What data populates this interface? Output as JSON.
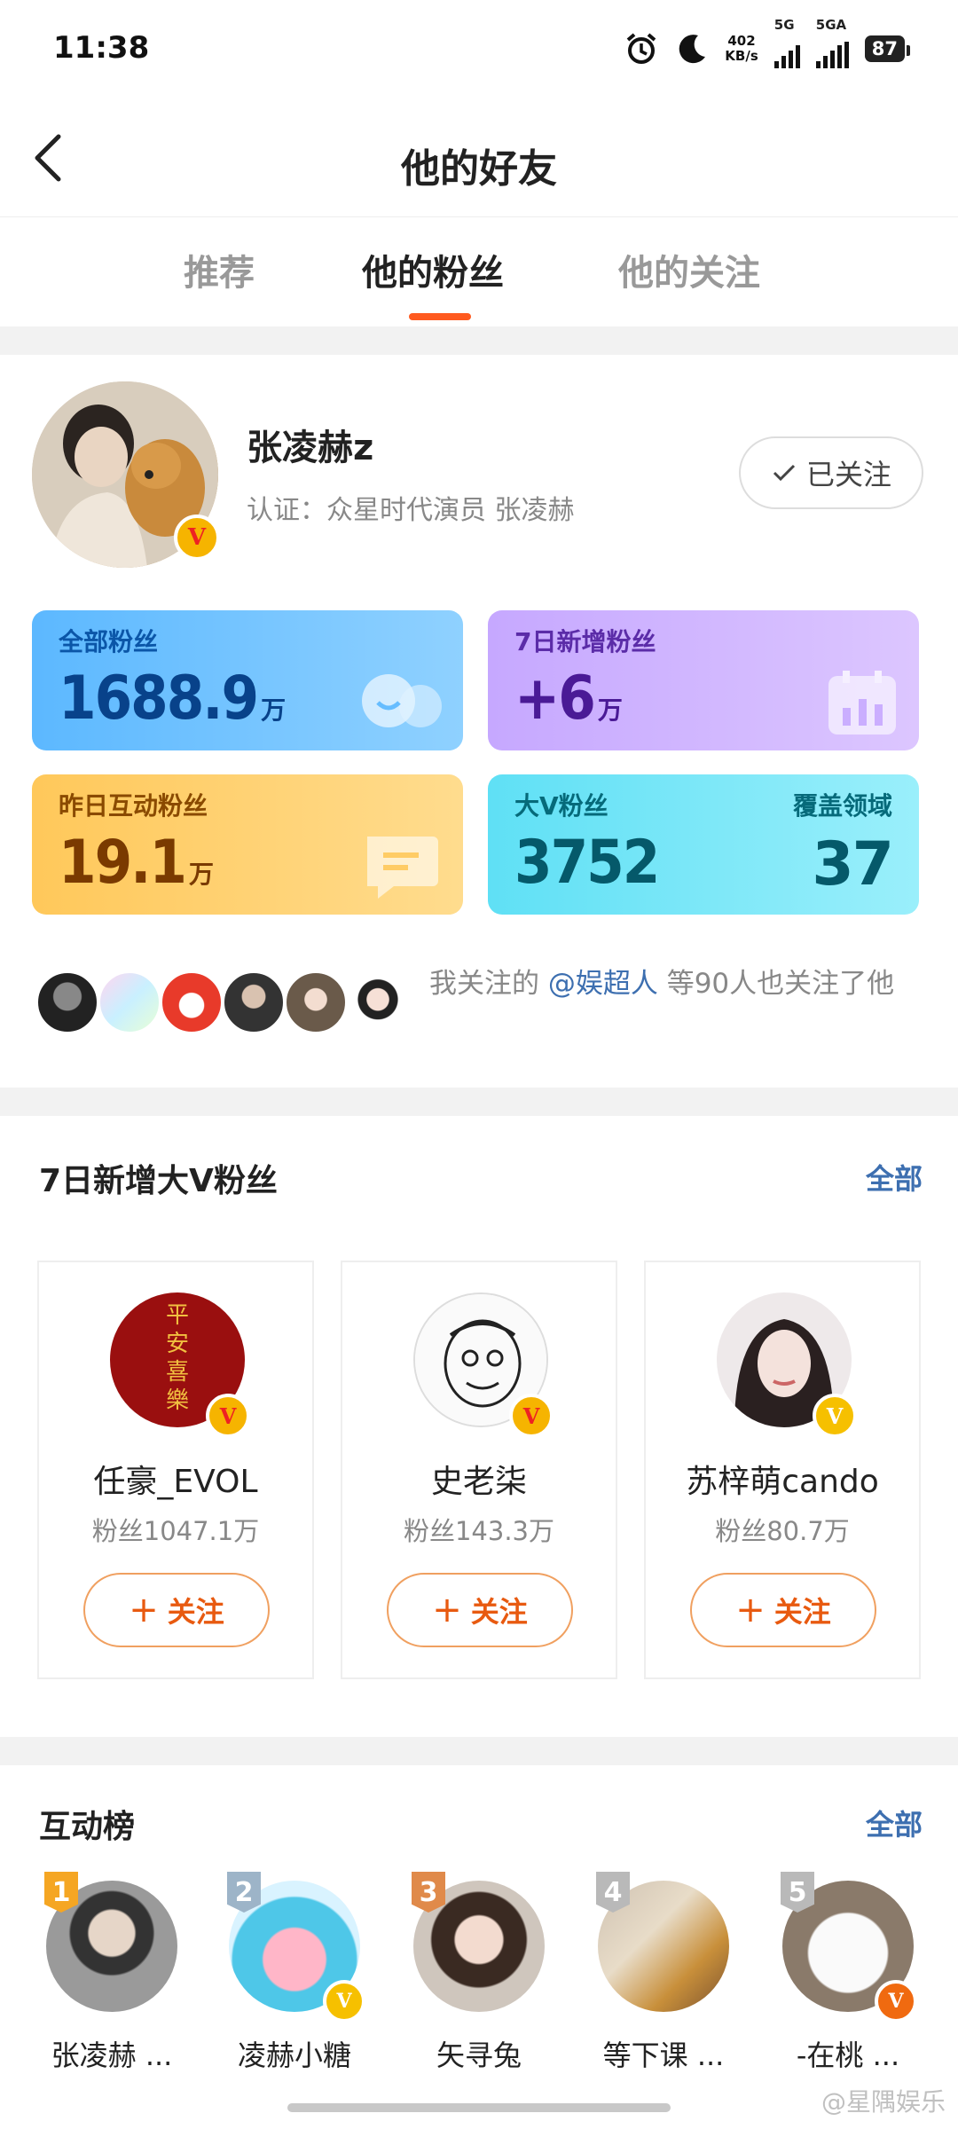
{
  "status_bar": {
    "time": "11:38",
    "net_speed_value": "402",
    "net_speed_unit": "KB/s",
    "sim1": "5G",
    "sim2": "5GA",
    "battery": "87"
  },
  "header": {
    "title": "他的好友"
  },
  "tabs": [
    {
      "label": "推荐",
      "active": false
    },
    {
      "label": "他的粉丝",
      "active": true
    },
    {
      "label": "他的关注",
      "active": false
    }
  ],
  "profile": {
    "name": "张凌赫z",
    "certification": "认证：众星时代演员 张凌赫",
    "follow_state": "已关注",
    "badge": "V"
  },
  "stats": {
    "all_fans": {
      "label": "全部粉丝",
      "value": "1688.9",
      "unit": "万"
    },
    "new_7d": {
      "label": "7日新增粉丝",
      "value": "+6",
      "unit": "万"
    },
    "interact_yesterday": {
      "label": "昨日互动粉丝",
      "value": "19.1",
      "unit": "万"
    },
    "bigv": {
      "label": "大V粉丝",
      "value": "3752",
      "label2": "覆盖领域",
      "value2": "37"
    }
  },
  "mutual": {
    "prefix": "我关注的 ",
    "mention": "@娱超人",
    "suffix": " 等90人也关注了他"
  },
  "new_bigv": {
    "title": "7日新增大V粉丝",
    "all_label": "全部",
    "items": [
      {
        "name": "任豪_EVOL",
        "fans": "粉丝1047.1万",
        "button": "关注"
      },
      {
        "name": "史老柒",
        "fans": "粉丝143.3万",
        "button": "关注"
      },
      {
        "name": "苏梓萌cando",
        "fans": "粉丝80.7万",
        "button": "关注"
      }
    ]
  },
  "ranking": {
    "title": "互动榜",
    "all_label": "全部",
    "items": [
      {
        "rank": "1",
        "name": "张凌赫 ..."
      },
      {
        "rank": "2",
        "name": "凌赫小糖"
      },
      {
        "rank": "3",
        "name": "矢寻兔"
      },
      {
        "rank": "4",
        "name": "等下课 ..."
      },
      {
        "rank": "5",
        "name": "-在桃 ..."
      }
    ]
  },
  "watermark": "@星隅娱乐",
  "avatar_seal_text": "平安喜樂",
  "colors": {
    "accent_orange": "#ff5a1f",
    "link_blue": "#3d6fb0",
    "rank_gold": "#f5a623",
    "rank_silver": "#9db4c8",
    "rank_bronze": "#e08a4a",
    "rank_gray": "#b9b9b9"
  }
}
